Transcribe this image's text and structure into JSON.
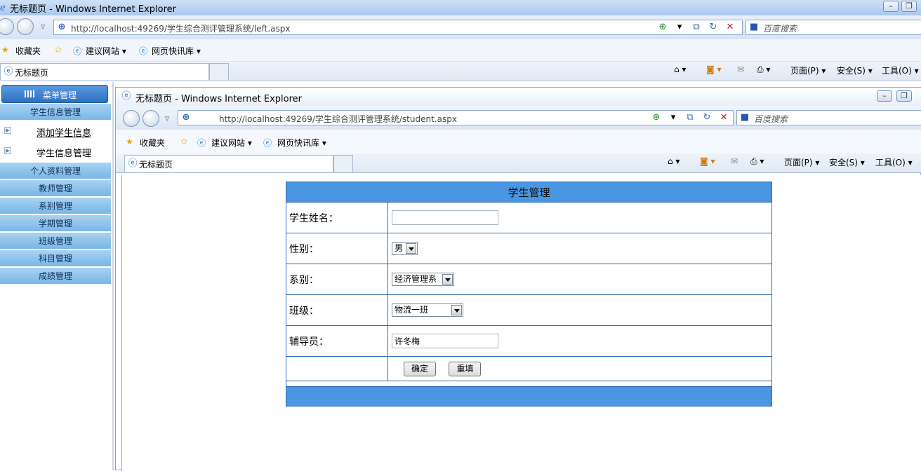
{
  "outer": {
    "title": "无标题页 - Windows Internet Explorer",
    "url": "http://localhost:49269/学生综合测评管理系统/left.aspx",
    "search_placeholder": "百度搜索",
    "favorites_label": "收藏夹",
    "suggested_sites": "建议网站 ▾",
    "web_slice": "网页快讯库 ▾",
    "tab_title": "无标题页",
    "page_menu": "页面(P) ▾",
    "safety_menu": "安全(S) ▾",
    "tools_menu": "工具(O) ▾"
  },
  "sidebar": {
    "header": "菜单管理",
    "items": [
      {
        "label": "学生信息管理"
      },
      {
        "label": "添加学生信息"
      },
      {
        "label": "学生信息管理"
      },
      {
        "label": "个人资料管理"
      },
      {
        "label": "教师管理"
      },
      {
        "label": "系别管理"
      },
      {
        "label": "学期管理"
      },
      {
        "label": "班级管理"
      },
      {
        "label": "科目管理"
      },
      {
        "label": "成绩管理"
      }
    ]
  },
  "inner": {
    "title": "无标题页 - Windows Internet Explorer",
    "url": "http://localhost:49269/学生综合测评管理系统/student.aspx",
    "search_placeholder": "百度搜索",
    "favorites_label": "收藏夹",
    "suggested_sites": "建议网站 ▾",
    "web_slice": "网页快讯库 ▾",
    "tab_title": "无标题页",
    "page_menu": "页面(P) ▾",
    "safety_menu": "安全(S) ▾",
    "tools_menu": "工具(O) ▾"
  },
  "form": {
    "header": "学生管理",
    "name_label": "学生姓名：",
    "name_value": "",
    "gender_label": "性别：",
    "gender_value": "男",
    "dept_label": "系别：",
    "dept_value": "经济管理系",
    "class_label": "班级：",
    "class_value": "物流一班",
    "counselor_label": "辅导员：",
    "counselor_value": "许冬梅",
    "submit_label": "确定",
    "reset_label": "重填"
  },
  "colors": {
    "header_blue": "#4a96e3",
    "border_blue": "#2f6db5",
    "menu_blue": "#79b6e6"
  }
}
